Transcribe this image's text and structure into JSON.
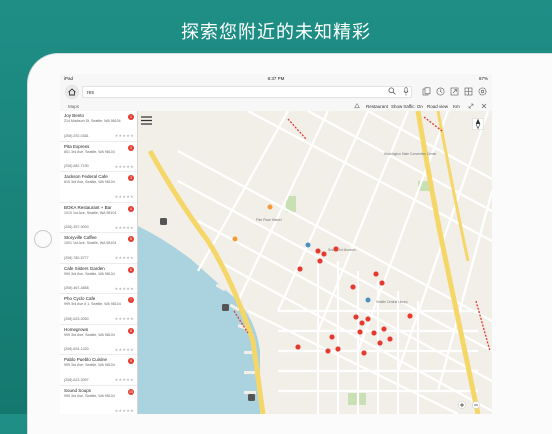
{
  "headline": "探索您附近的未知精彩",
  "status_bar": {
    "device": "iPad",
    "time": "6:37 PM",
    "battery": "87%"
  },
  "toolbar": {
    "search_value": "res",
    "icons": [
      "home-icon",
      "search-icon",
      "microphone-icon",
      "copy-icon",
      "history-icon",
      "share-icon",
      "grid-icon",
      "settings-icon"
    ]
  },
  "subbar": {
    "tab": "Maps",
    "options": [
      "Restaurant",
      "Show traffic: On",
      "Road view",
      "Km"
    ]
  },
  "results": [
    {
      "name": "Joy Bento",
      "address": "214 Madison St, Seattle, WA 98104",
      "phone": "(206) 292-0381",
      "badge": "1"
    },
    {
      "name": "Pita Express",
      "address": "801 3rd Ave, Seattle, WA 98104",
      "phone": "(206) 682-7190",
      "badge": "2"
    },
    {
      "name": "Jackson Federal Cafe",
      "address": "815 3rd Ave, Seattle, WA 98104",
      "phone": "",
      "badge": "3"
    },
    {
      "name": "BOKA Restaurant + Bar",
      "address": "1010 1st Ave, Seattle, WA 98104",
      "phone": "(206) 357-9000",
      "badge": "4"
    },
    {
      "name": "Storyville Coffee",
      "address": "1001 1st Ave, Seattle, WA 98104",
      "phone": "(206) 780-5777",
      "badge": "5"
    },
    {
      "name": "Cafe Sisters Garden",
      "address": "999 3rd Ave, Seattle, WA 98104",
      "phone": "(206) 467-4858",
      "badge": "6"
    },
    {
      "name": "Pho Cyclo Cafe",
      "address": "999 3rd Ave # 1, Seattle, WA 98104",
      "phone": "(206) 623-3050",
      "badge": "7"
    },
    {
      "name": "Homegrown",
      "address": "999 3rd Ave, Seattle, WA 98104",
      "phone": "(206) 624-1320",
      "badge": "8"
    },
    {
      "name": "Pablo Pueblo Cuisine",
      "address": "999 3rd Ave, Seattle, WA 98104",
      "phone": "(206) 623-3097",
      "badge": "9"
    },
    {
      "name": "Sound Soups",
      "address": "999 3rd Ave, Seattle, WA 98104",
      "phone": "",
      "badge": "10"
    }
  ],
  "map_labels": [
    "Washington State Convention Center",
    "Seattle Art Museum",
    "Seattle Central Library",
    "Pike Place Market"
  ],
  "colors": {
    "accent": "#1b867d",
    "pin": "#e23a2f",
    "freeway": "#f5d769",
    "water": "#aad3df"
  }
}
